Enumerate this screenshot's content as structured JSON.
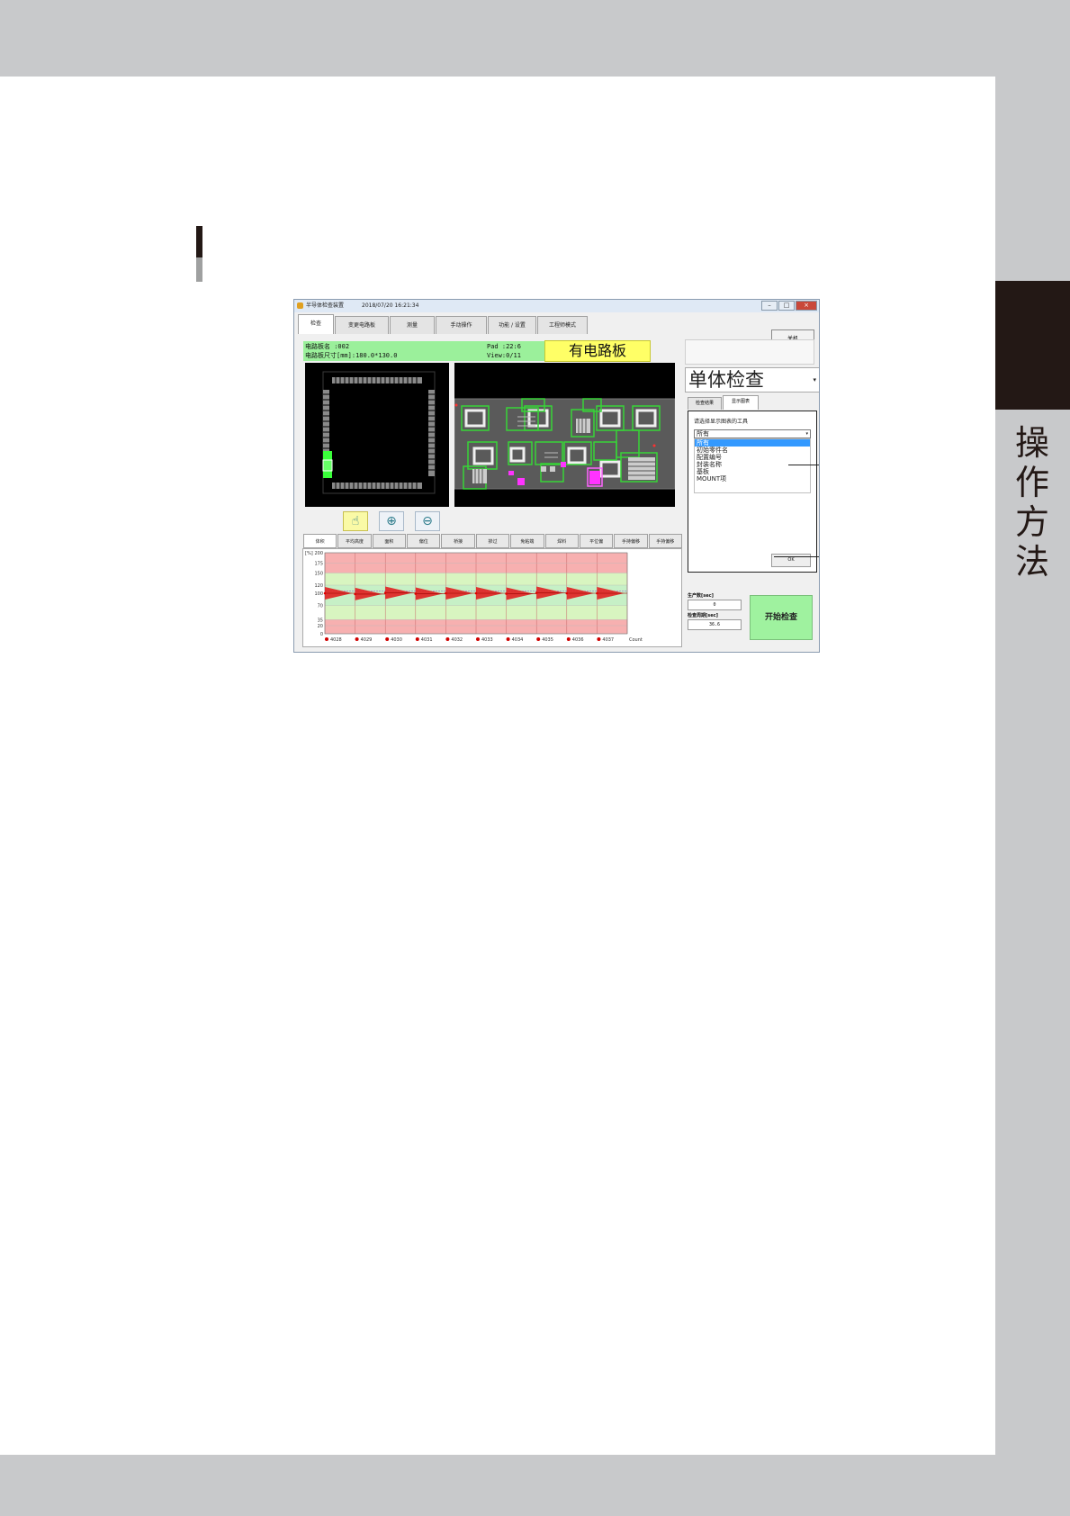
{
  "side_tab": {
    "text": "操作方法"
  },
  "window": {
    "title": "半导体检查装置",
    "datetime": "2018/07/20 16:21:34",
    "tabs": [
      "检查",
      "变更电路板",
      "测量",
      "手动操作",
      "功能 / 设置",
      "工程师模式"
    ],
    "exit_label": "关机"
  },
  "info": {
    "board_name_label": "电路板名 :002",
    "board_size_label": "电路板尺寸[mm]:180.0*130.0",
    "pad": "Pad :22:6",
    "view": "View:0/11",
    "board_status": "有电路板"
  },
  "tools": {
    "hand_icon": "hand-pointer-icon",
    "zoom_in_icon": "zoom-in-icon",
    "zoom_out_icon": "zoom-out-icon"
  },
  "bottom_tabs": [
    "体积",
    "平均高度",
    "面积",
    "偏位",
    "桥接",
    "掺过",
    "免粘端",
    "焊料",
    "平位偏",
    "手持偏移",
    "手持偏移"
  ],
  "right_panel": {
    "mode": "单体检查",
    "sub_tabs": [
      "检查结果",
      "显示图表"
    ],
    "dialog": {
      "prompt": "请选择显示图表的工具",
      "select_value": "所有",
      "options": [
        "所有",
        "初始零件名",
        "配置编号",
        "封装名称",
        "基板",
        "MOUNT项"
      ],
      "highlighted_index": 0,
      "ok_label": "OK"
    },
    "production_label": "生产数[sec]",
    "production_value": "0",
    "cycle_label": "检查周期[sec]",
    "cycle_value": "36.6",
    "start_label": "开始检查"
  },
  "colors": {
    "accent_green": "#9bf09b",
    "highlight_yellow": "#ffff66",
    "list_highlight": "#3399ff",
    "pcb_outline": "#37d437",
    "chart_red": "#e02020"
  },
  "chart_data": {
    "type": "line",
    "ylabel": "[%]",
    "y_ticks": [
      0,
      20,
      35,
      70,
      100,
      120,
      150,
      175,
      200
    ],
    "ylim": [
      0,
      200
    ],
    "x_ticks": [
      "4028",
      "4029",
      "4030",
      "4031",
      "4032",
      "4033",
      "4034",
      "4035",
      "4036",
      "4037"
    ],
    "x_end_label": "Count",
    "bands": [
      {
        "from": 0,
        "to": 35,
        "color": "#f7b0b0"
      },
      {
        "from": 35,
        "to": 70,
        "color": "#d8f5c0"
      },
      {
        "from": 70,
        "to": 120,
        "color": "#c6f0c6"
      },
      {
        "from": 120,
        "to": 150,
        "color": "#d8f5c0"
      },
      {
        "from": 150,
        "to": 200,
        "color": "#f7b0b0"
      }
    ],
    "average_line": 105,
    "series": [
      {
        "values": [
          100,
          98,
          101,
          99,
          100,
          100,
          99,
          101,
          100,
          100
        ]
      }
    ]
  }
}
